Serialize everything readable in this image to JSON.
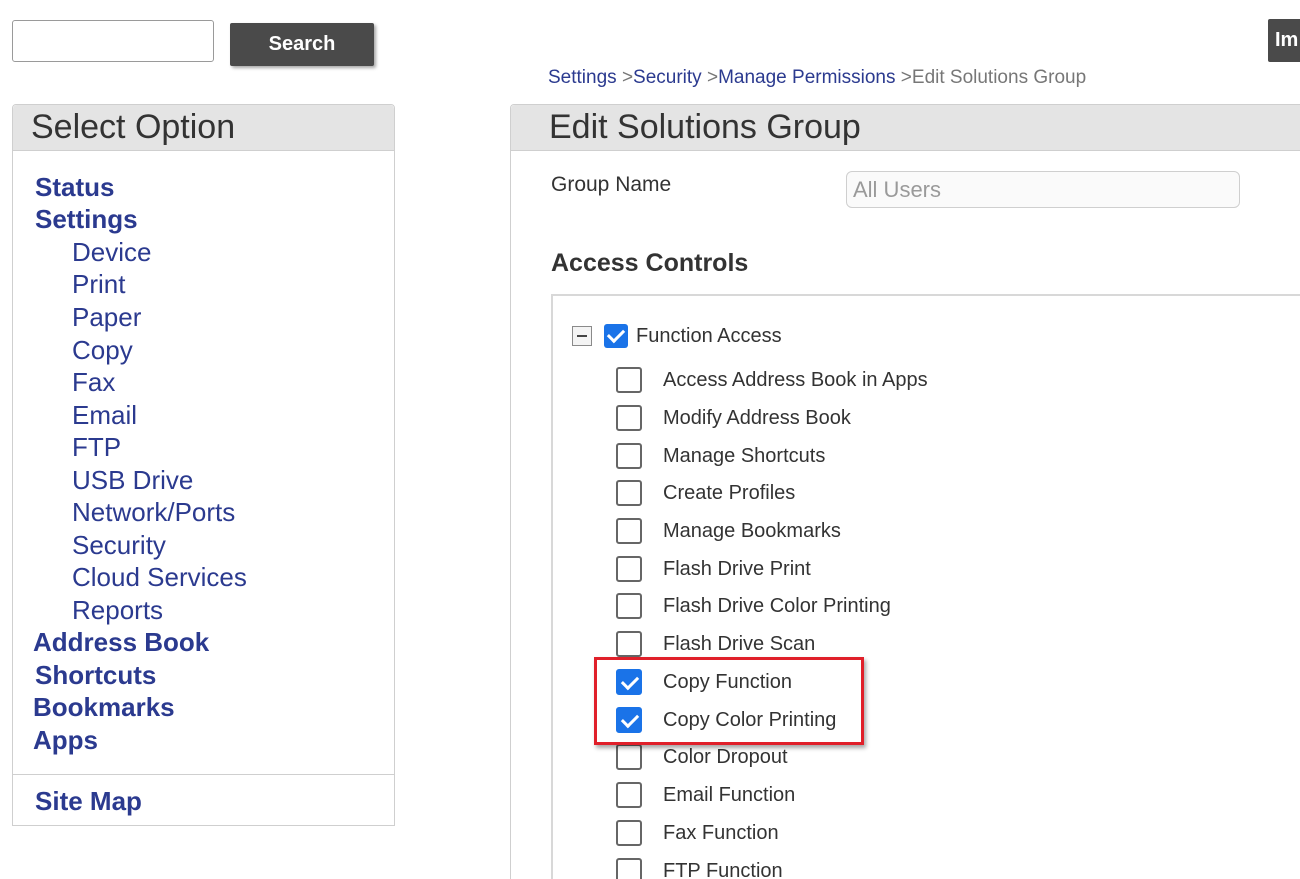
{
  "search": {
    "input_value": "",
    "button_label": "Search"
  },
  "import_button_label": "Im",
  "sidebar": {
    "title": "Select Option",
    "status": "Status",
    "settings": "Settings",
    "settings_items": [
      "Device",
      "Print",
      "Paper",
      "Copy",
      "Fax",
      "Email",
      "FTP",
      "USB Drive",
      "Network/Ports",
      "Security",
      "Cloud Services",
      "Reports"
    ],
    "address_book": "Address Book",
    "shortcuts": "Shortcuts",
    "bookmarks": "Bookmarks",
    "apps": "Apps",
    "site_map": "Site Map"
  },
  "breadcrumb": {
    "items": [
      "Settings",
      "Security",
      "Manage Permissions"
    ],
    "separator": ">",
    "current": "Edit Solutions Group"
  },
  "panel": {
    "title": "Edit Solutions Group",
    "group_name_label": "Group Name",
    "group_name_value": "All Users",
    "access_controls_title": "Access Controls"
  },
  "tree": {
    "root_label": "Function Access",
    "root_checked": true,
    "items": [
      {
        "label": "Access Address Book in Apps",
        "checked": false
      },
      {
        "label": "Modify Address Book",
        "checked": false
      },
      {
        "label": "Manage Shortcuts",
        "checked": false
      },
      {
        "label": "Create Profiles",
        "checked": false
      },
      {
        "label": "Manage Bookmarks",
        "checked": false
      },
      {
        "label": "Flash Drive Print",
        "checked": false
      },
      {
        "label": "Flash Drive Color Printing",
        "checked": false
      },
      {
        "label": "Flash Drive Scan",
        "checked": false
      },
      {
        "label": "Copy Function",
        "checked": true
      },
      {
        "label": "Copy Color Printing",
        "checked": true
      },
      {
        "label": "Color Dropout",
        "checked": false
      },
      {
        "label": "Email Function",
        "checked": false
      },
      {
        "label": "Fax Function",
        "checked": false
      },
      {
        "label": "FTP Function",
        "checked": false
      }
    ]
  },
  "colors": {
    "link": "#2b3a8f",
    "checkbox_checked": "#1a73e8",
    "highlight": "#e0202a",
    "button_dark": "#4a4a4a",
    "panel_header": "#e4e4e4"
  },
  "icons": {
    "collapse": "minus-square-icon",
    "checked": "checkmark-icon"
  }
}
